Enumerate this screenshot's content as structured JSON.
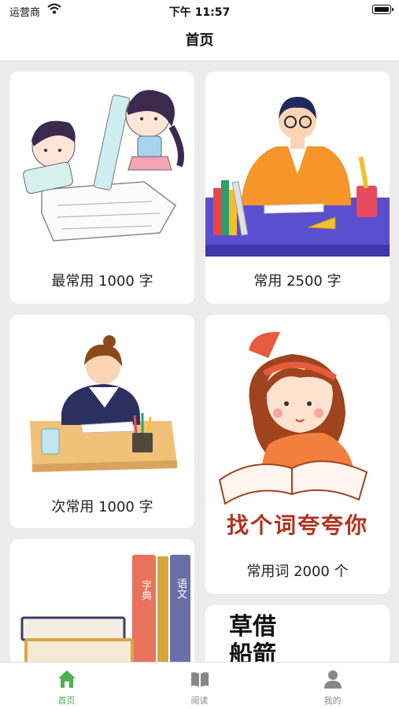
{
  "status_bar": {
    "carrier": "运营商",
    "time": "下午 11:57"
  },
  "navbar": {
    "title": "首页"
  },
  "cards": [
    {
      "label": "最常用 1000 字"
    },
    {
      "label": "常用 2500 字"
    },
    {
      "label": "次常用 1000 字"
    },
    {
      "label": "常用词 2000 个",
      "banner": "找个词夸夸你"
    },
    {
      "label": "",
      "book_spines": [
        "字典",
        "语文"
      ]
    },
    {
      "label": "",
      "calligraphy": "草借船箭"
    }
  ],
  "tabbar": {
    "items": [
      {
        "label": "首页",
        "icon": "home-icon",
        "active": true
      },
      {
        "label": "阅读",
        "icon": "book-icon",
        "active": false
      },
      {
        "label": "我的",
        "icon": "person-icon",
        "active": false
      }
    ],
    "active_color": "#4caf50",
    "inactive_color": "#888888"
  }
}
